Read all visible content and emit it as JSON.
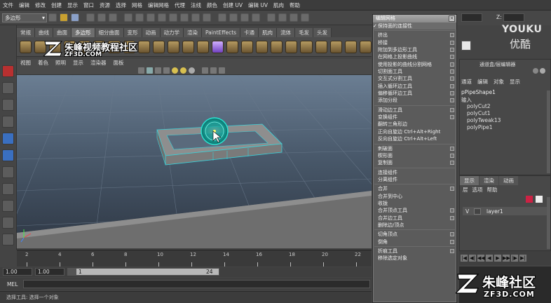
{
  "menubar": [
    "文件",
    "编辑",
    "修改",
    "创建",
    "显示",
    "窗口",
    "资源",
    "选择",
    "网格",
    "编辑网格",
    "代理",
    "法线",
    "颜色",
    "创建 UV",
    "编辑 UV",
    "肌肉",
    "帮助"
  ],
  "toolbar": {
    "mode": "多边形",
    "z_label": "Z:"
  },
  "shelf_tabs": [
    {
      "label": "常规",
      "active": false
    },
    {
      "label": "曲线",
      "active": false
    },
    {
      "label": "曲面",
      "active": false
    },
    {
      "label": "多边形",
      "active": true
    },
    {
      "label": "细分曲面",
      "active": false
    },
    {
      "label": "变形",
      "active": false
    },
    {
      "label": "动画",
      "active": false
    },
    {
      "label": "动力学",
      "active": false
    },
    {
      "label": "渲染",
      "active": false
    },
    {
      "label": "PaintEffects",
      "active": false
    },
    {
      "label": "卡通",
      "active": false
    },
    {
      "label": "肌肉",
      "active": false
    },
    {
      "label": "流体",
      "active": false
    },
    {
      "label": "毛发",
      "active": false
    },
    {
      "label": "头发",
      "active": false
    }
  ],
  "watermark": {
    "top_logo": "朱峰视频教程社区",
    "top_url": "ZF3D.COM",
    "bottom_logo": "朱峰社区",
    "bottom_url": "ZF3D.COM",
    "brand": "YOUKU",
    "brand_cn": "优酷"
  },
  "viewport_menu": [
    "视图",
    "着色",
    "照明",
    "显示",
    "渲染器",
    "面板"
  ],
  "timeline": {
    "ticks": [
      "2",
      "4",
      "6",
      "8",
      "10",
      "12",
      "14",
      "16",
      "18",
      "20",
      "22"
    ]
  },
  "range": {
    "start": "1.00",
    "start2": "1.00",
    "frame": "1",
    "end": "24"
  },
  "mel": {
    "label": "MEL"
  },
  "help_line": "选择工具: 选择一个对象",
  "edit_menu": {
    "title": "编辑网格",
    "items": [
      {
        "label": "保持面的连接性",
        "check": true,
        "box": false
      },
      {
        "sep": true
      },
      {
        "label": "挤出",
        "box": true
      },
      {
        "label": "桥接",
        "box": true
      },
      {
        "label": "附加到多边形工具",
        "box": true
      },
      {
        "label": "在网格上投影曲线",
        "box": true
      },
      {
        "label": "使用投影的曲线分割网格",
        "box": true
      },
      {
        "label": "切割面工具",
        "box": true
      },
      {
        "label": "交互式分割工具",
        "box": true
      },
      {
        "label": "插入循环边工具",
        "box": true
      },
      {
        "label": "偏移循环边工具",
        "box": true
      },
      {
        "label": "添加分段",
        "box": true
      },
      {
        "sep": true
      },
      {
        "label": "滑动边工具",
        "box": true
      },
      {
        "label": "变换组件",
        "box": true
      },
      {
        "label": "翻转三角形边",
        "box": false
      },
      {
        "label": "正向自旋边  Ctrl+Alt+Right",
        "box": false
      },
      {
        "label": "反向自旋边  Ctrl+Alt+Left",
        "box": false
      },
      {
        "sep": true
      },
      {
        "label": "刺破面",
        "box": true
      },
      {
        "label": "楔形面",
        "box": true
      },
      {
        "label": "复制面",
        "box": true
      },
      {
        "sep": true
      },
      {
        "label": "连接组件",
        "box": false
      },
      {
        "label": "分离组件",
        "box": false
      },
      {
        "sep": true
      },
      {
        "label": "合并",
        "box": true
      },
      {
        "label": "合并到中心",
        "box": false
      },
      {
        "label": "收拢",
        "box": false
      },
      {
        "label": "合并顶点工具",
        "box": true
      },
      {
        "label": "合并边工具",
        "box": true
      },
      {
        "label": "删除边/顶点",
        "box": false
      },
      {
        "sep": true
      },
      {
        "label": "切角顶点",
        "box": true
      },
      {
        "label": "倒角",
        "box": true
      },
      {
        "sep": true
      },
      {
        "label": "折痕工具",
        "box": true
      },
      {
        "label": "移除选定对象",
        "box": false
      }
    ]
  },
  "channel_box": {
    "tabs": [
      "通道",
      "编辑",
      "对象",
      "显示"
    ],
    "header": "通道盒/层编辑器",
    "object": "pPipeShape1",
    "inputs_label": "输入",
    "inputs": [
      "polyCut2",
      "polyCut1",
      "polyTweak13",
      "polyPipe1"
    ]
  },
  "layers": {
    "tabs": [
      "显示",
      "渲染",
      "动画"
    ],
    "menu": [
      "层",
      "选项",
      "帮助"
    ],
    "layer_v": "V",
    "layer_name": "layer1"
  },
  "colors": {
    "selection": "#3ad1d9",
    "manip": "#1fb6a8"
  }
}
